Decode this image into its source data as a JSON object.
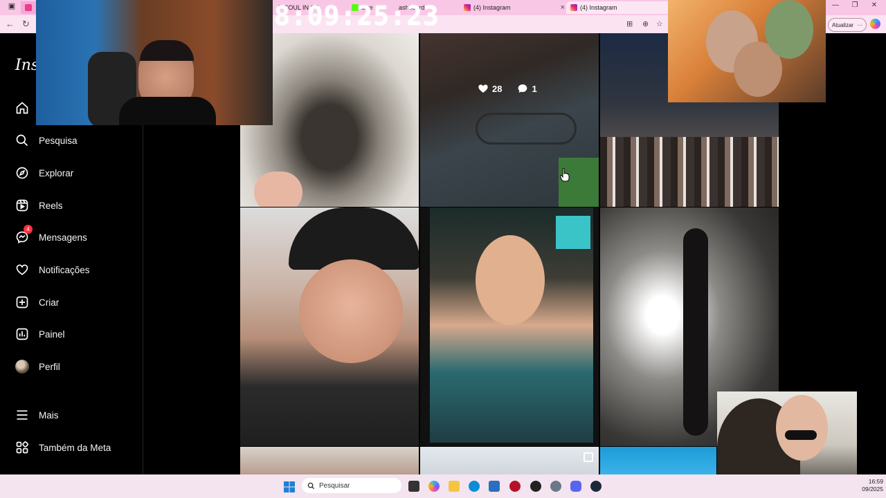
{
  "browser": {
    "tabs": [
      {
        "label": "T  COUL IN ST"
      },
      {
        "label": "Stre"
      },
      {
        "label": "ashboard"
      },
      {
        "label": "(4) Instagram"
      },
      {
        "label": "(4) Instagram"
      }
    ],
    "update_button": "Atualizar",
    "update_more": "···"
  },
  "overlay": {
    "clock": "8:09:25:23"
  },
  "sidebar": {
    "logo": "Inst",
    "items": [
      {
        "label": ""
      },
      {
        "label": "Pesquisa"
      },
      {
        "label": "Explorar"
      },
      {
        "label": "Reels"
      },
      {
        "label": "Mensagens",
        "badge": "4"
      },
      {
        "label": "Notificações"
      },
      {
        "label": "Criar"
      },
      {
        "label": "Painel"
      },
      {
        "label": "Perfil"
      },
      {
        "label": "Mais"
      },
      {
        "label": "Também da Meta"
      }
    ]
  },
  "post": {
    "likes": "28",
    "comments": "1"
  },
  "taskbar": {
    "search_placeholder": "Pesquisar",
    "time": "16:59",
    "date": "09/2025"
  },
  "colors": {
    "tab_bg": "#f9c7e6",
    "notification_badge": "#ff3040",
    "sidebar_bg": "#000000"
  }
}
